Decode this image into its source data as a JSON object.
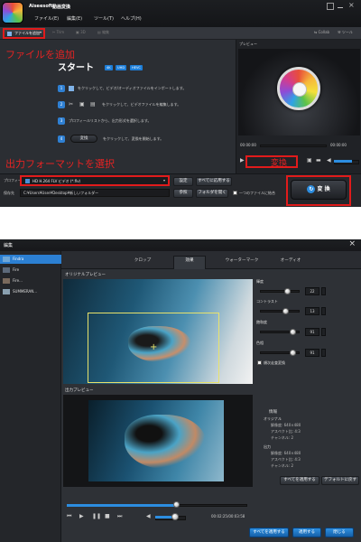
{
  "top_window": {
    "brand": "Aiseesoft",
    "title": "動画変換",
    "menu": [
      "ファイル(E)",
      "編集(E)",
      "ツール(T)",
      "ヘルプ(H)"
    ],
    "toolbar": {
      "add_file": "ファイルを追加",
      "trim": "Trim",
      "3d": "3D",
      "edit": "編集",
      "collab": "Collab",
      "tools": "ツール"
    },
    "preview_label": "プレビュー",
    "annotation_add_file": "ファイルを追加",
    "annotation_output_format": "出力フォーマットを選択",
    "annotation_convert": "変換",
    "start": {
      "title": "スタート",
      "badges": [
        "4K",
        "UHD",
        "HEVC"
      ],
      "steps": [
        {
          "num": "1",
          "text": "をクリックして、ビデオ/オーディオファイルをインポートします。"
        },
        {
          "num": "2",
          "text": "をクリックして、ビデオファイルを編集します。"
        },
        {
          "num": "3",
          "text": "プロフィールリストから、出力形式を選択します。"
        },
        {
          "num": "4",
          "chip": "変換",
          "text": "をクリックして、変換を開始します。"
        }
      ]
    },
    "player": {
      "time": "00:00:00",
      "time_end": "00:00:00"
    },
    "profile": {
      "label": "プロフィール",
      "value": "HD H.264 FLV ビデオ (*.flv)",
      "settings": "設定",
      "apply_all": "すべてに応用する"
    },
    "destination": {
      "label": "保存先",
      "value": "C:¥Users¥User¥Desktop¥新しいフォルダー",
      "browse": "参照",
      "open_folder": "フォルダを開く",
      "merge": "一つのファイルに結合"
    },
    "convert_button": "変 換"
  },
  "edit_window": {
    "title": "編集",
    "file_list": [
      "Findra",
      "Fire",
      "Fire...",
      "SUMMERAN..."
    ],
    "tabs": [
      "クロップ",
      "効果",
      "ウォーターマーク",
      "オーディオ"
    ],
    "active_tab": "効果",
    "original_preview": "オリジナルプレビュー",
    "output_preview": "出力プレビュー",
    "adjust": [
      {
        "label": "輝度",
        "value": "22",
        "level": 0.62
      },
      {
        "label": "コントラスト",
        "value": "13",
        "level": 0.58
      },
      {
        "label": "飽和度",
        "value": "91",
        "level": 0.78
      },
      {
        "label": "色相",
        "value": "91",
        "level": 0.78
      }
    ],
    "deinterlace": "順次走査変換",
    "info": {
      "title": "情報",
      "original_label": "オリジナル",
      "original_lines": [
        "解像度: 640×480",
        "アスペクト比: 4:3",
        "チャンネル: 2"
      ],
      "output_label": "出力",
      "output_lines": [
        "解像度: 640×480",
        "アスペクト比: 4:3",
        "チャンネル: 2"
      ]
    },
    "apply_all": "すべてを適用する",
    "reset": "デフォルトに戻す",
    "time": "00:02:25/00:03:58",
    "footer": {
      "apply_all": "すべてを適用する",
      "apply": "適用する",
      "close": "閉じる"
    },
    "close_icon": "×"
  },
  "colors": {
    "annotation_red": "#e11b1b",
    "accent_blue": "#2c8de0"
  }
}
